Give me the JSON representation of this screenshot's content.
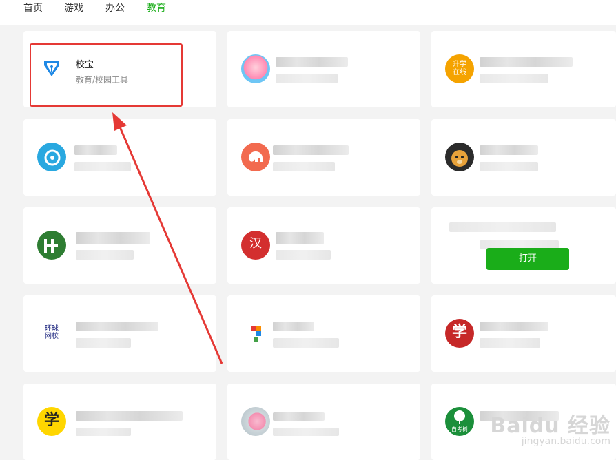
{
  "tabs": [
    {
      "label": "首页",
      "active": false
    },
    {
      "label": "游戏",
      "active": false
    },
    {
      "label": "办公",
      "active": false
    },
    {
      "label": "教育",
      "active": true
    }
  ],
  "featured_app": {
    "name": "校宝",
    "category": "教育/校园工具"
  },
  "icon_texts": {
    "shengxue": "升学在线",
    "han": "汉",
    "huanqiu": "环球网校",
    "xue": "学",
    "zikaoshu": "自考树"
  },
  "open_button": "打开",
  "watermark": {
    "main": "Baidu 经验",
    "sub": "jingyan.baidu.com"
  },
  "colors": {
    "accent": "#1aad19",
    "highlight": "#e53935",
    "arrow": "#e53935"
  }
}
